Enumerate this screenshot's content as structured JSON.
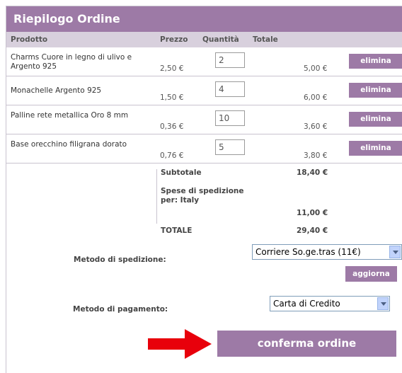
{
  "summary": {
    "title": "Riepilogo Ordine",
    "columns": {
      "product": "Prodotto",
      "price": "Prezzo",
      "quantity": "Quantità",
      "total": "Totale"
    },
    "items": [
      {
        "name": "Charms Cuore in legno di ulivo e Argento 925",
        "price": "2,50 €",
        "quantity": "2",
        "total": "5,00 €",
        "remove_label": "elimina"
      },
      {
        "name": "Monachelle Argento 925",
        "price": "1,50 €",
        "quantity": "4",
        "total": "6,00 €",
        "remove_label": "elimina"
      },
      {
        "name": "Palline rete metallica Oro 8 mm",
        "price": "0,36 €",
        "quantity": "10",
        "total": "3,60 €",
        "remove_label": "elimina"
      },
      {
        "name": "Base orecchino filigrana dorato",
        "price": "0,76 €",
        "quantity": "5",
        "total": "3,80 €",
        "remove_label": "elimina"
      }
    ],
    "subtotal_label": "Subtotale",
    "subtotal_value": "18,40 €",
    "shipping_label": "Spese di spedizione per: Italy",
    "shipping_value": "11,00 €",
    "total_label": "TOTALE",
    "total_value": "29,40 €"
  },
  "shipping_method": {
    "label": "Metodo di spedizione:",
    "selected": "Corriere So.ge.tras (11€)",
    "update_label": "aggiorna"
  },
  "payment_method": {
    "label": "Metodo di pagamento:",
    "selected": "Carta di Credito"
  },
  "confirm_label": "conferma ordine",
  "colors": {
    "accent": "#9d7aa6",
    "header_row": "#d8d0dd",
    "arrow": "#e8000b"
  }
}
